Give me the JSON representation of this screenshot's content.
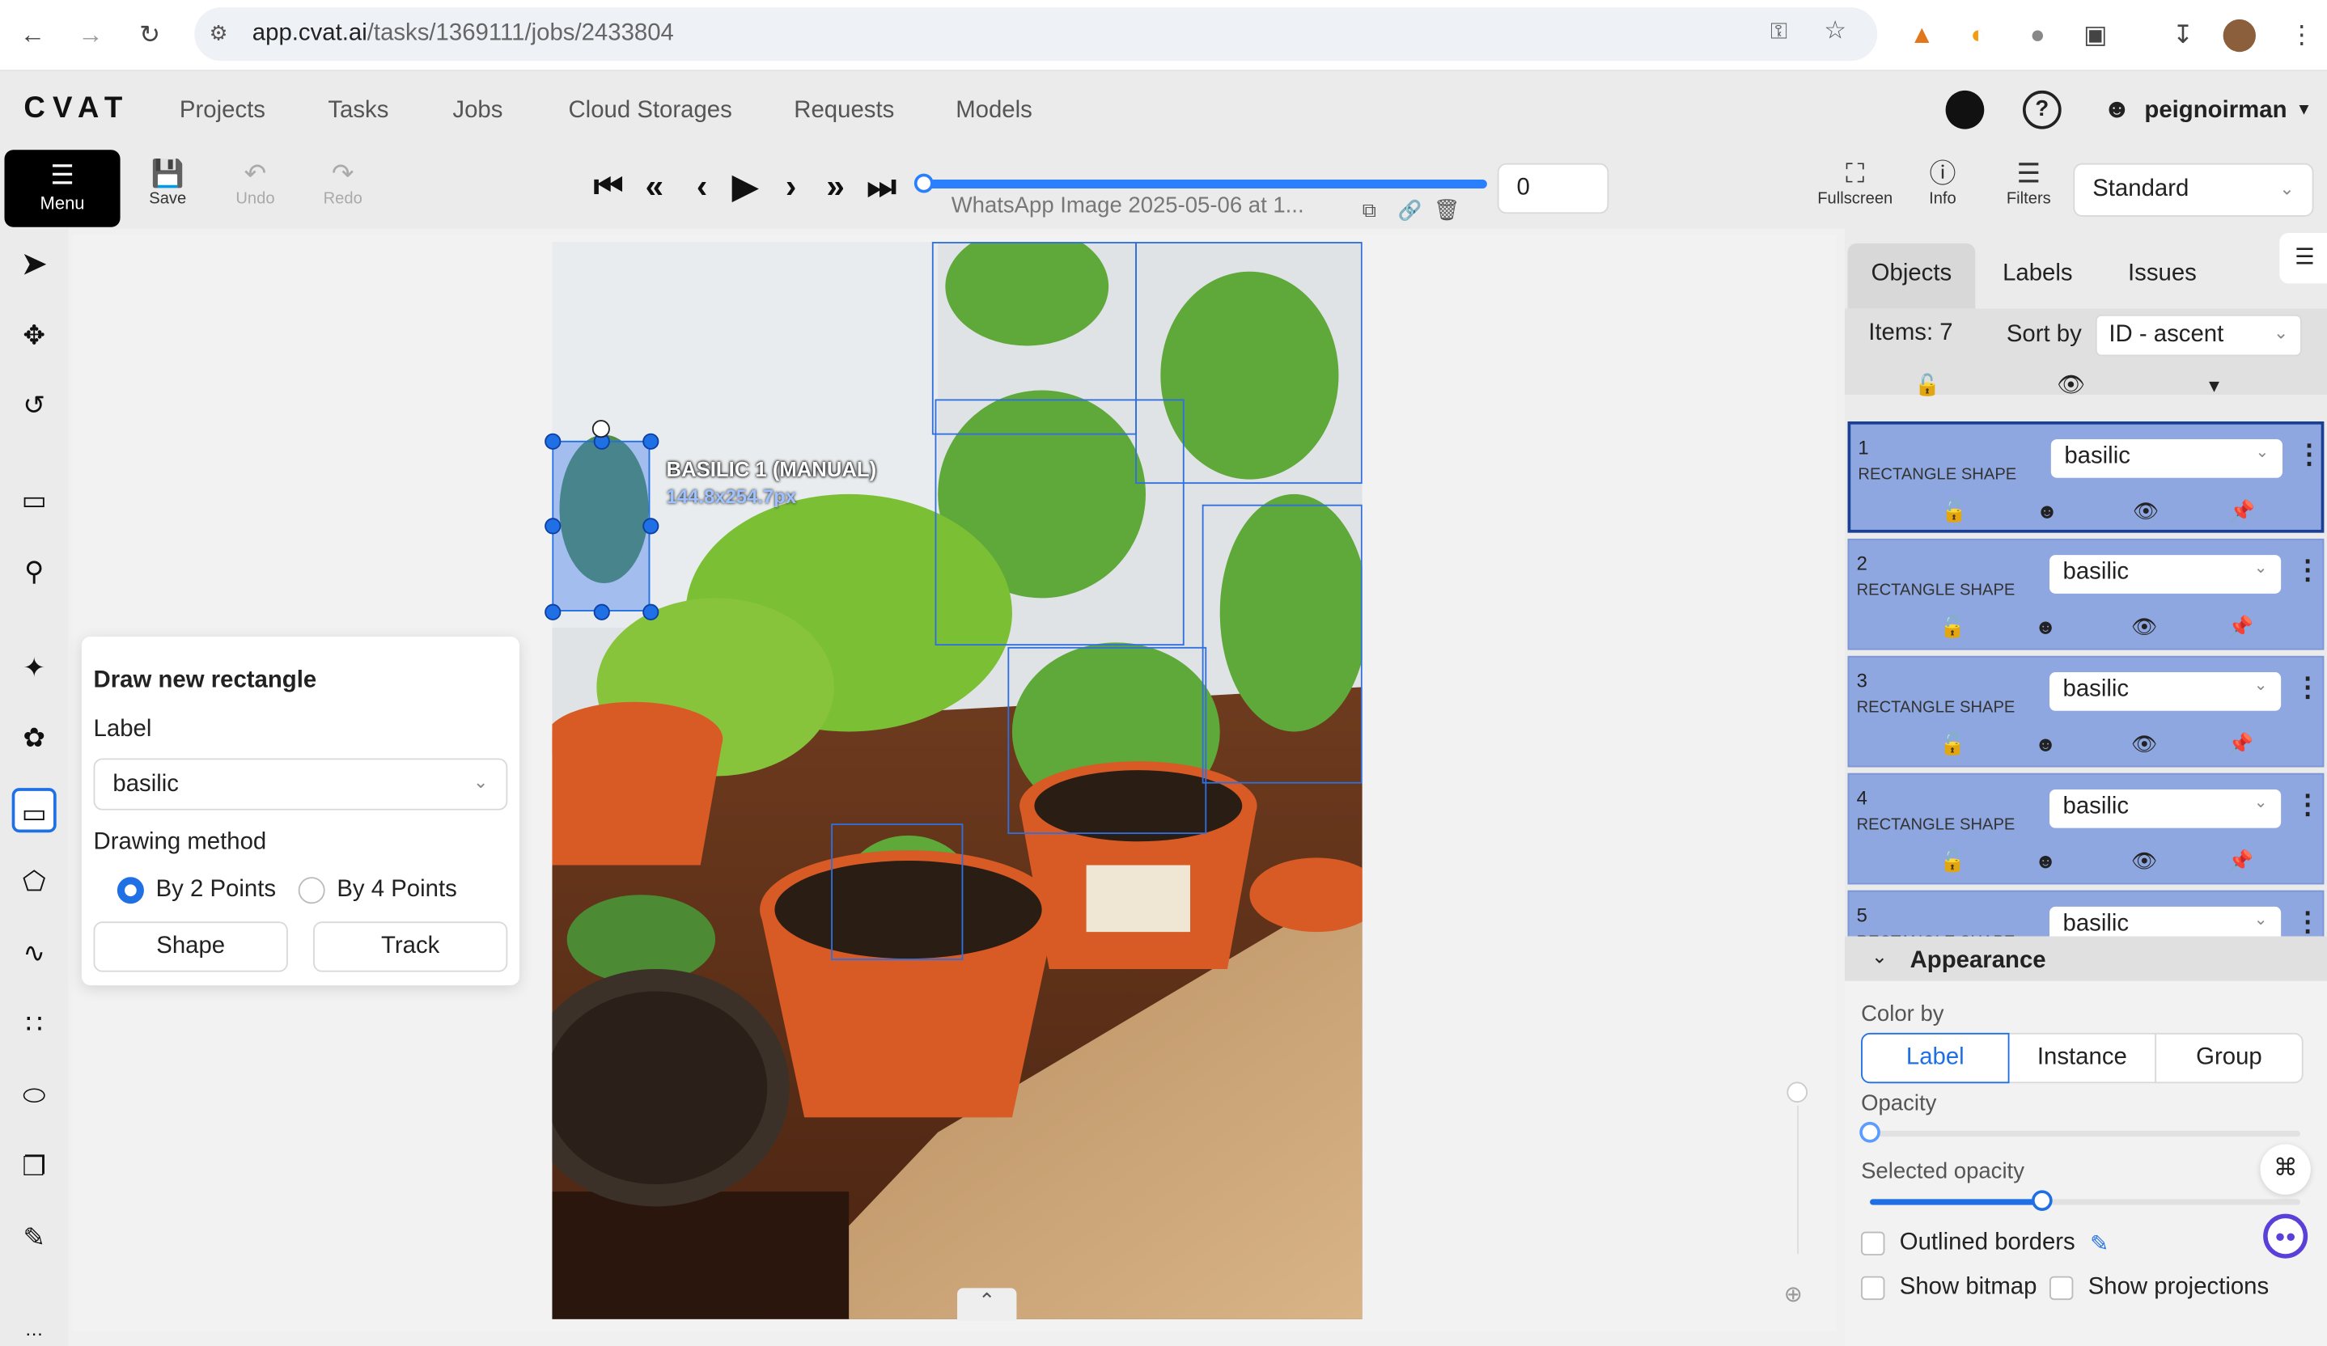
{
  "browser": {
    "url_host": "app.cvat.ai",
    "url_path": "/tasks/1369111/jobs/2433804"
  },
  "header": {
    "logo": "CVAT",
    "nav": [
      "Projects",
      "Tasks",
      "Jobs",
      "Cloud Storages",
      "Requests",
      "Models"
    ],
    "user": "peignoirman"
  },
  "toolbar": {
    "menu_label": "Menu",
    "save_label": "Save",
    "undo_label": "Undo",
    "redo_label": "Redo",
    "frame_name": "WhatsApp Image 2025-05-06 at 1...",
    "frame_number": "0",
    "frame_progress": 1.0,
    "fullscreen_label": "Fullscreen",
    "info_label": "Info",
    "filters_label": "Filters",
    "workspace": "Standard"
  },
  "canvas": {
    "active_label": "BASILIC 1 (MANUAL)",
    "active_size": "144.8x254.7px"
  },
  "draw_popover": {
    "title": "Draw new rectangle",
    "label_caption": "Label",
    "label_value": "basilic",
    "method_caption": "Drawing method",
    "method_options": [
      "By 2 Points",
      "By 4 Points"
    ],
    "selected_method": "By 2 Points",
    "shape_button": "Shape",
    "track_button": "Track"
  },
  "sidebar": {
    "tabs": [
      "Objects",
      "Labels",
      "Issues"
    ],
    "active_tab": "Objects",
    "items_count": "Items: 7",
    "sort_caption": "Sort by",
    "sort_value": "ID - ascent",
    "objects": [
      {
        "id": "1",
        "type": "RECTANGLE SHAPE",
        "label": "basilic"
      },
      {
        "id": "2",
        "type": "RECTANGLE SHAPE",
        "label": "basilic"
      },
      {
        "id": "3",
        "type": "RECTANGLE SHAPE",
        "label": "basilic"
      },
      {
        "id": "4",
        "type": "RECTANGLE SHAPE",
        "label": "basilic"
      },
      {
        "id": "5",
        "type": "RECTANGLE SHAPE",
        "label": "basilic"
      }
    ],
    "appearance": {
      "title": "Appearance",
      "color_by_caption": "Color by",
      "color_by_options": [
        "Label",
        "Instance",
        "Group"
      ],
      "color_by_selected": "Label",
      "opacity_caption": "Opacity",
      "opacity_value": 0.0,
      "selected_opacity_caption": "Selected opacity",
      "selected_opacity_value": 0.4,
      "outlined_borders": "Outlined borders",
      "show_bitmap": "Show bitmap",
      "show_projections": "Show projections"
    }
  },
  "colors": {
    "accent": "#1f6fe5",
    "object_row": "#8ea7e0",
    "box": "#2f6fe0"
  }
}
